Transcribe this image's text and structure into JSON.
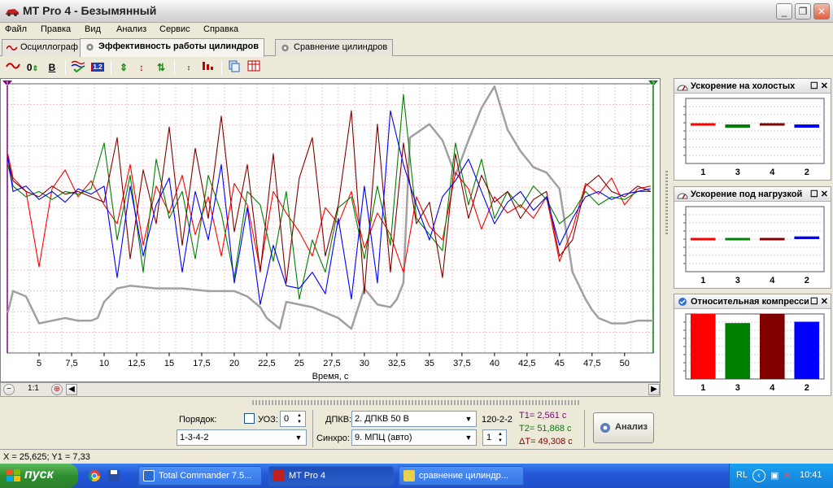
{
  "window": {
    "title": "MT Pro 4 - Безымянный",
    "controls": [
      "_",
      "❐",
      "✕"
    ]
  },
  "menu": [
    "Файл",
    "Правка",
    "Вид",
    "Анализ",
    "Сервис",
    "Справка"
  ],
  "tabs": [
    {
      "label": "Осциллограф",
      "active": false
    },
    {
      "label": "Эффективность работы цилиндров",
      "active": true
    },
    {
      "label": "Сравнение цилиндров",
      "active": false
    }
  ],
  "toolbar": {
    "zero_label": "0",
    "bold_label": "B",
    "ruler_label": "1.2"
  },
  "colors": {
    "cyl1": "#ff0000",
    "cyl3": "#008000",
    "cyl4": "#800000",
    "cyl2": "#0000ff",
    "reference": "#a0a0a0",
    "marker_left": "#800080",
    "marker_right": "#008000"
  },
  "chart_data": {
    "type": "line",
    "xlabel": "Время, с",
    "xlim": [
      2.56,
      52.2
    ],
    "ylim": [
      0,
      1
    ],
    "x_ticks": [
      "5",
      "7,5",
      "10",
      "12,5",
      "15",
      "17,5",
      "20",
      "22,5",
      "25",
      "27,5",
      "30",
      "32,5",
      "35",
      "37,5",
      "40",
      "42,5",
      "45",
      "47,5",
      "50"
    ],
    "x_tick_values": [
      5,
      7.5,
      10,
      12.5,
      15,
      17.5,
      20,
      22.5,
      25,
      27.5,
      30,
      32.5,
      35,
      37.5,
      40,
      42.5,
      45,
      47.5,
      50
    ],
    "grid": true,
    "markers": {
      "left": "1",
      "right": "2"
    },
    "series": [
      {
        "color": "#a0a0a0",
        "x": [
          2.6,
          3,
          4,
          5,
          6,
          7,
          8,
          9,
          9.5,
          10,
          11,
          12,
          14,
          16,
          18,
          20,
          21,
          22,
          22.5,
          23.5,
          24,
          26,
          28,
          29,
          30,
          31,
          32,
          32.5,
          33,
          33.5,
          35,
          36,
          37,
          38,
          39,
          40,
          41,
          42,
          43,
          44,
          45,
          46,
          47,
          47.5,
          48,
          49,
          50,
          51,
          52.2
        ],
        "y": [
          0.15,
          0.23,
          0.21,
          0.11,
          0.12,
          0.13,
          0.12,
          0.12,
          0.13,
          0.19,
          0.24,
          0.25,
          0.24,
          0.24,
          0.23,
          0.23,
          0.21,
          0.17,
          0.13,
          0.09,
          0.19,
          0.17,
          0.13,
          0.09,
          0.24,
          0.18,
          0.17,
          0.2,
          0.26,
          0.8,
          0.85,
          0.79,
          0.66,
          0.79,
          0.91,
          0.99,
          0.83,
          0.75,
          0.69,
          0.67,
          0.61,
          0.3,
          0.2,
          0.16,
          0.13,
          0.11,
          0.11,
          0.12,
          0.12
        ]
      },
      {
        "color": "#ff0000",
        "x": [
          2.6,
          3,
          4,
          5,
          6,
          7,
          8,
          9,
          10,
          11,
          12,
          13,
          14,
          15,
          16,
          17,
          18,
          19,
          20,
          21,
          22,
          23,
          24,
          25,
          26,
          27,
          28,
          29,
          30,
          31,
          32,
          33,
          34,
          35,
          36,
          37,
          38,
          39,
          40,
          41,
          42,
          43,
          44,
          45,
          46,
          47,
          48,
          49,
          50,
          51,
          52
        ],
        "y": [
          0.74,
          0.65,
          0.6,
          0.32,
          0.61,
          0.68,
          0.58,
          0.64,
          0.55,
          0.48,
          0.7,
          0.4,
          0.62,
          0.52,
          0.66,
          0.44,
          0.58,
          0.36,
          0.63,
          0.55,
          0.31,
          0.6,
          0.52,
          0.45,
          0.36,
          0.54,
          0.48,
          0.6,
          0.39,
          0.52,
          0.44,
          0.3,
          0.58,
          0.47,
          0.42,
          0.67,
          0.61,
          0.46,
          0.58,
          0.52,
          0.55,
          0.5,
          0.58,
          0.34,
          0.46,
          0.63,
          0.59,
          0.65,
          0.55,
          0.61,
          0.62
        ]
      },
      {
        "color": "#008000",
        "x": [
          2.6,
          3,
          4,
          5,
          6,
          7,
          8,
          9,
          10,
          11,
          12,
          13,
          14,
          15,
          16,
          17,
          18,
          19,
          20,
          21,
          22,
          23,
          24,
          25,
          26,
          27,
          28,
          29,
          30,
          31,
          32,
          33,
          34,
          35,
          36,
          37,
          38,
          39,
          40,
          41,
          42,
          43,
          44,
          45,
          46,
          47,
          48,
          49,
          50,
          51,
          52
        ],
        "y": [
          0.7,
          0.62,
          0.58,
          0.6,
          0.57,
          0.6,
          0.59,
          0.61,
          0.78,
          0.42,
          0.66,
          0.3,
          0.72,
          0.5,
          0.6,
          0.35,
          0.66,
          0.52,
          0.28,
          0.6,
          0.55,
          0.34,
          0.6,
          0.2,
          0.42,
          0.3,
          0.54,
          0.58,
          0.35,
          0.62,
          0.4,
          0.96,
          0.5,
          0.44,
          0.38,
          0.78,
          0.55,
          0.72,
          0.5,
          0.6,
          0.54,
          0.62,
          0.57,
          0.48,
          0.52,
          0.6,
          0.55,
          0.58,
          0.57,
          0.6,
          0.6
        ]
      },
      {
        "color": "#800000",
        "x": [
          2.6,
          3,
          4,
          5,
          6,
          7,
          8,
          9,
          10,
          11,
          12,
          13,
          14,
          15,
          16,
          17,
          18,
          19,
          20,
          21,
          22,
          23,
          24,
          25,
          26,
          27,
          28,
          29,
          30,
          31,
          32,
          33,
          34,
          35,
          36,
          37,
          38,
          39,
          40,
          41,
          42,
          43,
          44,
          45,
          46,
          47,
          48,
          49,
          50,
          51,
          52
        ],
        "y": [
          0.72,
          0.64,
          0.6,
          0.58,
          0.62,
          0.59,
          0.6,
          0.58,
          0.56,
          0.8,
          0.35,
          0.68,
          0.48,
          0.84,
          0.4,
          0.76,
          0.5,
          0.88,
          0.45,
          0.7,
          0.3,
          0.74,
          0.26,
          0.65,
          0.8,
          0.36,
          0.55,
          0.9,
          0.22,
          0.85,
          0.3,
          0.78,
          0.48,
          0.56,
          0.28,
          0.74,
          0.5,
          0.66,
          0.56,
          0.6,
          0.5,
          0.57,
          0.6,
          0.36,
          0.42,
          0.62,
          0.66,
          0.6,
          0.58,
          0.62,
          0.6
        ]
      },
      {
        "color": "#0000ff",
        "x": [
          2.6,
          3,
          4,
          5,
          6,
          7,
          8,
          9,
          10,
          11,
          12,
          13,
          14,
          15,
          16,
          17,
          18,
          19,
          20,
          21,
          22,
          23,
          24,
          25,
          26,
          27,
          28,
          29,
          30,
          31,
          32,
          33,
          34,
          35,
          36,
          37,
          38,
          39,
          40,
          41,
          42,
          43,
          44,
          45,
          46,
          47,
          48,
          49,
          50,
          51,
          52
        ],
        "y": [
          0.73,
          0.6,
          0.62,
          0.57,
          0.6,
          0.56,
          0.61,
          0.59,
          0.62,
          0.28,
          0.62,
          0.36,
          0.55,
          0.65,
          0.3,
          0.6,
          0.42,
          0.7,
          0.26,
          0.54,
          0.18,
          0.4,
          0.25,
          0.24,
          0.3,
          0.22,
          0.5,
          0.2,
          0.62,
          0.26,
          0.9,
          0.7,
          0.55,
          0.42,
          0.58,
          0.64,
          0.72,
          0.6,
          0.48,
          0.56,
          0.6,
          0.53,
          0.58,
          0.4,
          0.5,
          0.58,
          0.6,
          0.57,
          0.59,
          0.6,
          0.61
        ]
      }
    ]
  },
  "panels": [
    {
      "title": "Ускорение на холостых",
      "categories": [
        "1",
        "3",
        "4",
        "2"
      ],
      "values": [
        0.01,
        -0.05,
        -0.02,
        -0.05
      ],
      "ylim": [
        -0.6,
        0.4
      ],
      "colors": [
        "#ff0000",
        "#008000",
        "#800000",
        "#0000ff"
      ]
    },
    {
      "title": "Ускорение под нагрузкой",
      "categories": [
        "1",
        "3",
        "4",
        "2"
      ],
      "values": [
        0.03,
        0.03,
        0.03,
        0.05
      ],
      "ylim": [
        -0.6,
        0.6
      ],
      "colors": [
        "#ff0000",
        "#008000",
        "#800000",
        "#0000ff"
      ]
    },
    {
      "title": "Относительная компрессия",
      "categories": [
        "1",
        "3",
        "4",
        "2"
      ],
      "values": [
        1.0,
        0.86,
        1.0,
        0.88
      ],
      "ylim": [
        0,
        1.0
      ],
      "colors": [
        "#ff0000",
        "#008000",
        "#800000",
        "#0000ff"
      ]
    }
  ],
  "hscroll": {
    "zoom_label": "1:1"
  },
  "controls": {
    "order_label": "Порядок:",
    "order_value": "1-3-4-2",
    "uoz_label": "УОЗ:",
    "uoz_value": "0",
    "dpkv_label": "ДПКВ:",
    "dpkv_value": "2. ДПКВ 50 В",
    "dpkv_extra": "120-2-2",
    "sync_label": "Синхро:",
    "sync_value": "9. МПЦ (авто)",
    "sync_spin_value": "1",
    "t1": "T1= 2,561 с",
    "t2": "T2= 51,868 с",
    "dt": "ΔT= 49,308 с",
    "analyze_label": "Анализ"
  },
  "status": {
    "coords": "X = 25,625; Y1 = 7,33"
  },
  "taskbar": {
    "start_label": "пуск",
    "tasks": [
      {
        "label": "Total Commander 7.5...",
        "active": false
      },
      {
        "label": "MT Pro 4",
        "active": true
      },
      {
        "label": "сравнение цилиндр...",
        "active": false
      }
    ],
    "lang": "RL",
    "time": "10:41"
  }
}
